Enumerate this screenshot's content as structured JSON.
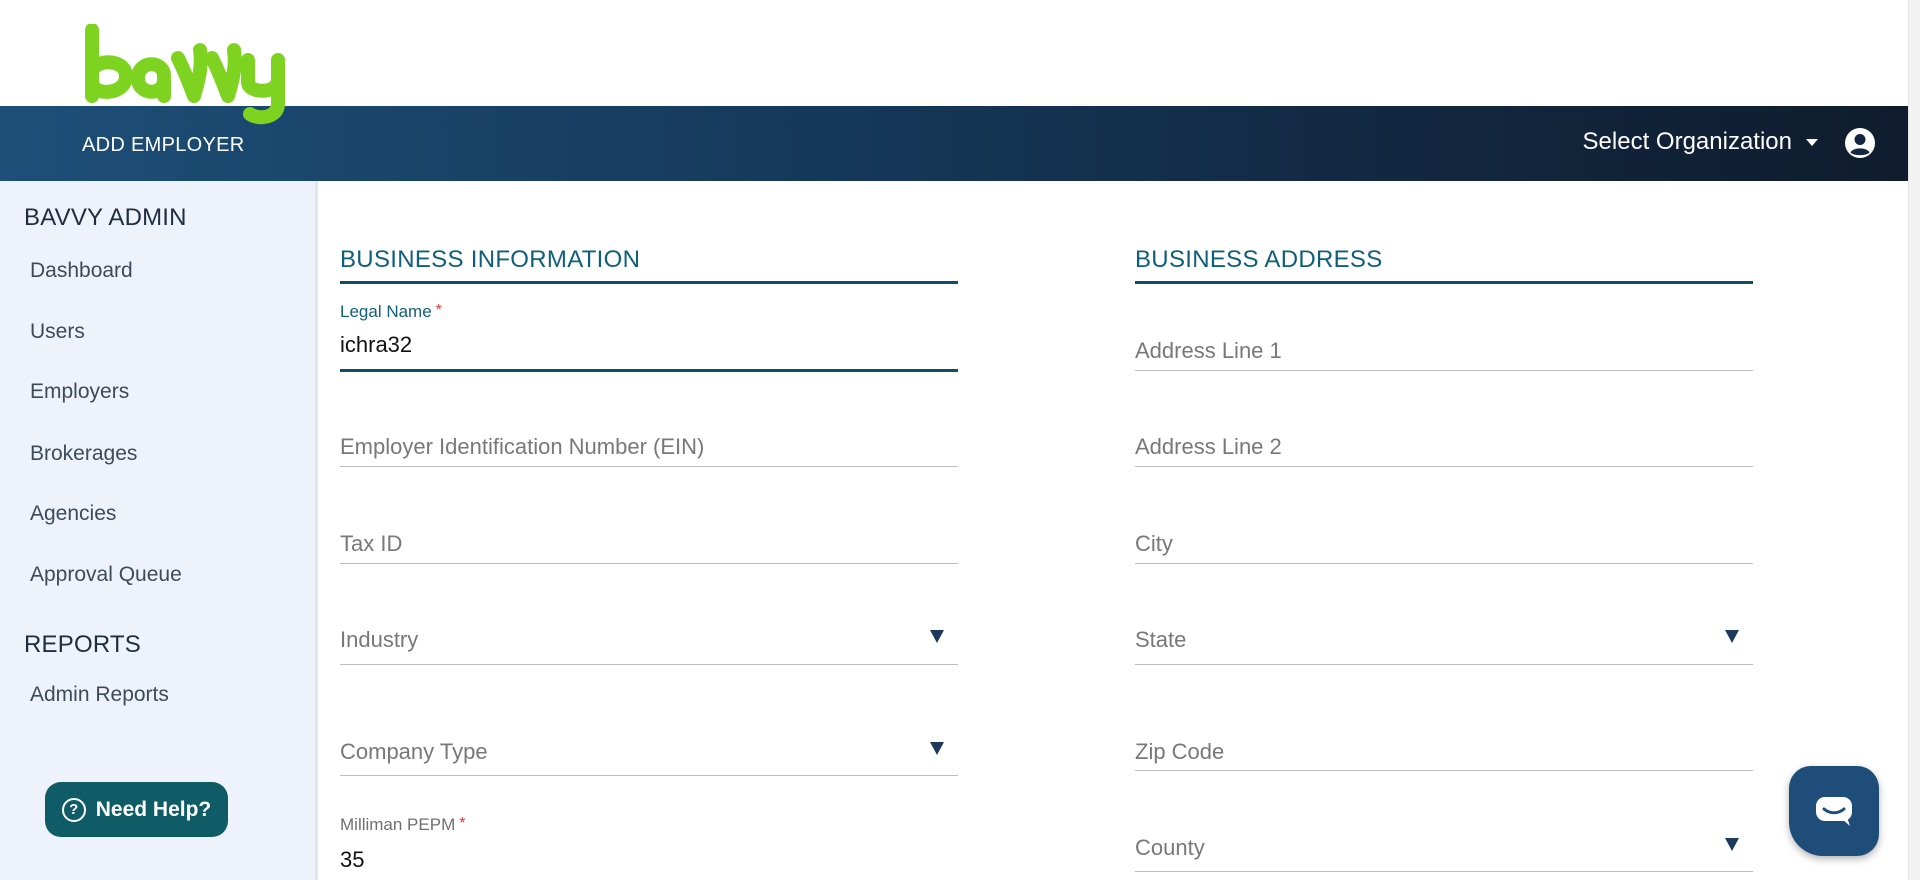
{
  "brand": {
    "logo_text": "bavvy",
    "logo_color": "#7ed321"
  },
  "header": {
    "page_heading": "ADD EMPLOYER",
    "org_select_label": "Select Organization",
    "account_icon": "account-circle-icon"
  },
  "sidebar": {
    "sections": [
      {
        "title": "BAVVY ADMIN",
        "items": [
          "Dashboard",
          "Users",
          "Employers",
          "Brokerages",
          "Agencies",
          "Approval Queue"
        ]
      },
      {
        "title": "REPORTS",
        "items": [
          "Admin Reports"
        ]
      }
    ],
    "help_button": {
      "label": "Need Help?",
      "icon": "question-circle-icon"
    }
  },
  "form": {
    "business_information": {
      "title": "BUSINESS INFORMATION",
      "legal_name": {
        "label": "Legal Name",
        "required": "*",
        "value": "ichra32"
      },
      "ein": {
        "placeholder": "Employer Identification Number (EIN)"
      },
      "tax_id": {
        "placeholder": "Tax ID"
      },
      "industry": {
        "placeholder": "Industry"
      },
      "company_type": {
        "placeholder": "Company Type"
      },
      "milliman_pepm": {
        "label": "Milliman PEPM",
        "required": "*",
        "value": "35"
      }
    },
    "business_address": {
      "title": "BUSINESS ADDRESS",
      "address_line_1": {
        "placeholder": "Address Line 1"
      },
      "address_line_2": {
        "placeholder": "Address Line 2"
      },
      "city": {
        "placeholder": "City"
      },
      "state": {
        "placeholder": "State"
      },
      "zip_code": {
        "placeholder": "Zip Code"
      },
      "county": {
        "placeholder": "County"
      }
    }
  },
  "chat": {
    "icon": "chat-bubble-icon"
  },
  "colors": {
    "header_start": "#1d4f78",
    "header_end": "#0f1c2e",
    "accent_teal": "#0f5f7a",
    "sidebar_bg": "#eef3fb",
    "help_button_bg": "#0f5c66",
    "chat_button_bg": "#1e4d79",
    "required": "#e53935"
  }
}
